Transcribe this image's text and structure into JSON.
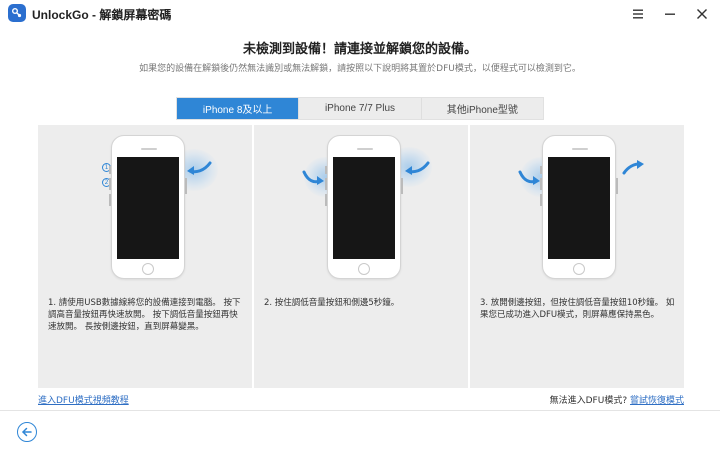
{
  "app": {
    "title": "UnlockGo - 解鎖屏幕密碼"
  },
  "header": {
    "heading": "未檢測到設備！請連接並解鎖您的設備。",
    "subheading": "如果您的設備在解鎖後仍然無法識別或無法解鎖，請按照以下說明將其置於DFU模式，以便程式可以檢測到它。"
  },
  "tabs": [
    {
      "label": "iPhone 8及以上",
      "active": true
    },
    {
      "label": "iPhone 7/7 Plus",
      "active": false
    },
    {
      "label": "其他iPhone型號",
      "active": false
    }
  ],
  "steps": {
    "step1_markers": [
      "1",
      "2"
    ],
    "panel1_text": "1. 請使用USB數據線將您的設備連接到電腦。 按下調高音量按鈕再快速放開。 按下調低音量按鈕再快速放開。 長按側邊按鈕，直到屏幕變黑。",
    "panel2_text": "2. 按住調低音量按鈕和側邊5秒鐘。",
    "panel3_text": "3. 放開側邊按鈕，但按住調低音量按鈕10秒鐘。 如果您已成功進入DFU模式，則屏幕應保持黑色。"
  },
  "footer": {
    "tutorial_link": "進入DFU模式視頻教程",
    "cannot_enter_text": "無法進入DFU模式?",
    "recovery_link": "嘗試恢復模式"
  },
  "colors": {
    "accent": "#2f86d6",
    "link": "#2f6fc4",
    "screen": "#161616",
    "panel_bg": "#ededed"
  },
  "icons": {
    "logo": "unlockgo-logo-icon",
    "menu": "hamburger-menu-icon",
    "minimize": "minimize-icon",
    "close": "close-icon",
    "back": "back-arrow-icon"
  }
}
